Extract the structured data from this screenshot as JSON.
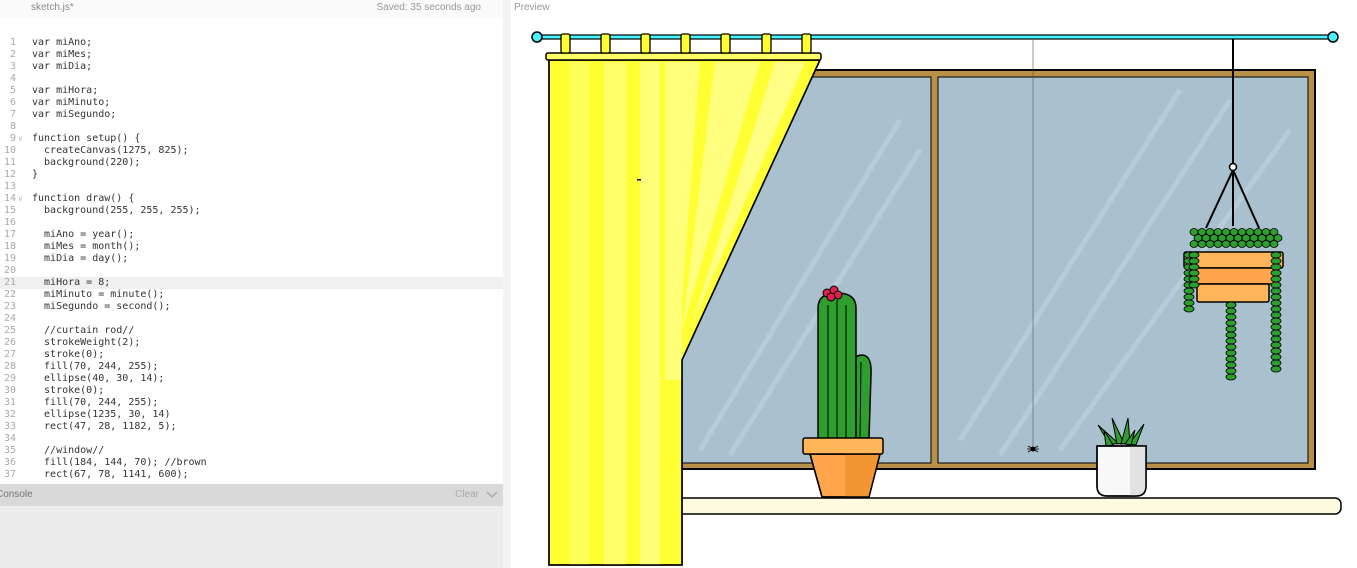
{
  "editor": {
    "filename": "sketch.js*",
    "saved_status": "Saved: 35 seconds ago",
    "highlighted_line": 21,
    "lines": [
      {
        "n": "1",
        "t": "var miAno;"
      },
      {
        "n": "2",
        "t": "var miMes;"
      },
      {
        "n": "3",
        "t": "var miDia;"
      },
      {
        "n": "4",
        "t": ""
      },
      {
        "n": "5",
        "t": "var miHora;"
      },
      {
        "n": "6",
        "t": "var miMinuto;"
      },
      {
        "n": "7",
        "t": "var miSegundo;"
      },
      {
        "n": "8",
        "t": ""
      },
      {
        "n": "9",
        "t": "function setup() {",
        "fold": true
      },
      {
        "n": "10",
        "t": "  createCanvas(1275, 825);"
      },
      {
        "n": "11",
        "t": "  background(220);"
      },
      {
        "n": "12",
        "t": "}"
      },
      {
        "n": "13",
        "t": ""
      },
      {
        "n": "14",
        "t": "function draw() {",
        "fold": true
      },
      {
        "n": "15",
        "t": "  background(255, 255, 255);"
      },
      {
        "n": "16",
        "t": ""
      },
      {
        "n": "17",
        "t": "  miAno = year();"
      },
      {
        "n": "18",
        "t": "  miMes = month();"
      },
      {
        "n": "19",
        "t": "  miDia = day();"
      },
      {
        "n": "20",
        "t": ""
      },
      {
        "n": "21",
        "t": "  miHora = 8;"
      },
      {
        "n": "22",
        "t": "  miMinuto = minute();"
      },
      {
        "n": "23",
        "t": "  miSegundo = second();"
      },
      {
        "n": "24",
        "t": ""
      },
      {
        "n": "25",
        "t": "  //curtain rod//"
      },
      {
        "n": "26",
        "t": "  strokeWeight(2);"
      },
      {
        "n": "27",
        "t": "  stroke(0);"
      },
      {
        "n": "28",
        "t": "  fill(70, 244, 255);"
      },
      {
        "n": "29",
        "t": "  ellipse(40, 30, 14);"
      },
      {
        "n": "30",
        "t": "  stroke(0);"
      },
      {
        "n": "31",
        "t": "  fill(70, 244, 255);"
      },
      {
        "n": "32",
        "t": "  ellipse(1235, 30, 14)"
      },
      {
        "n": "33",
        "t": "  rect(47, 28, 1182, 5);"
      },
      {
        "n": "34",
        "t": ""
      },
      {
        "n": "35",
        "t": "  //window//"
      },
      {
        "n": "36",
        "t": "  fill(184, 144, 70); //brown"
      },
      {
        "n": "37",
        "t": "  rect(67, 78, 1141, 600);"
      }
    ]
  },
  "console": {
    "label": "Console",
    "clear_label": "Clear"
  },
  "preview": {
    "label": "Preview",
    "colors": {
      "rod": "#46f4ff",
      "window_frame": "#b89046",
      "glass": "#a9c1ce",
      "curtain": "#ffff33",
      "pot": "#ffa64d",
      "cactus": "#2e9e2e",
      "shelf": "#fffbe0"
    }
  }
}
